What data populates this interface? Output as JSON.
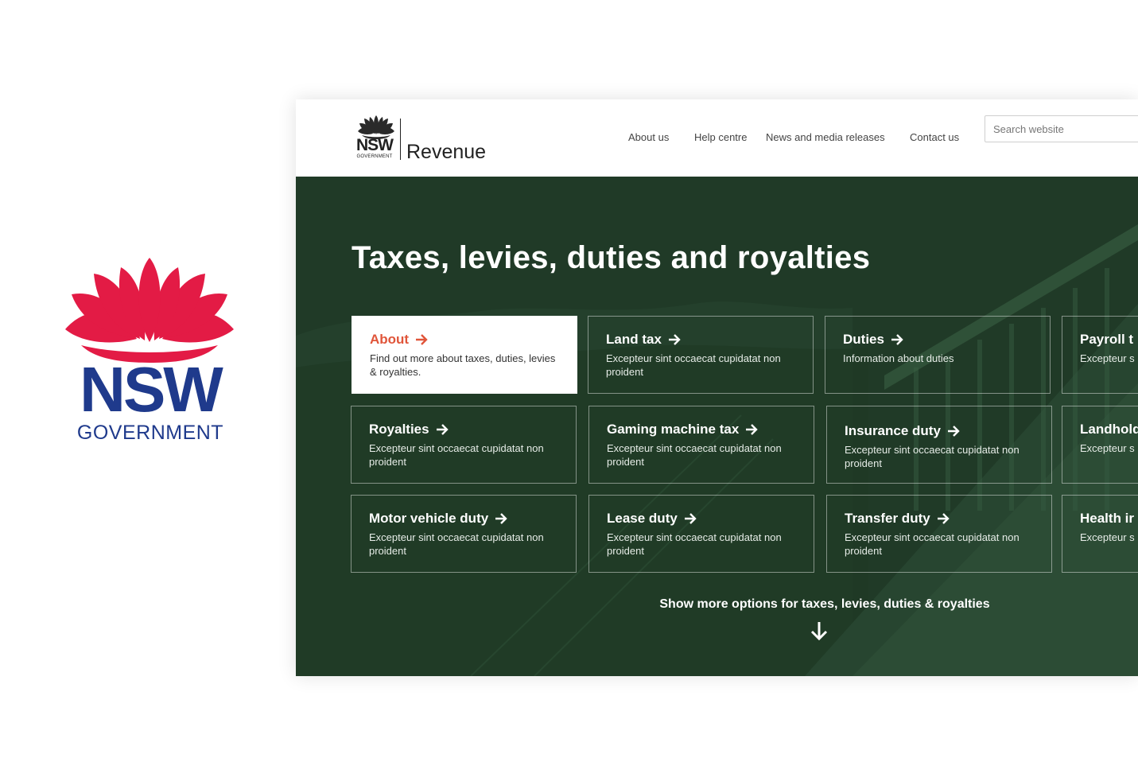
{
  "brand": {
    "nsw": "NSW",
    "government": "GOVERNMENT",
    "waratah_red": "#e31b45",
    "navy": "#1f3a8c"
  },
  "header": {
    "logo_nsw": "NSW",
    "logo_government": "GOVERNMENT",
    "brand_name": "Revenue",
    "nav": [
      "About us",
      "Help centre",
      "News and media releases",
      "Contact us"
    ],
    "search_placeholder": "Search website"
  },
  "hero": {
    "title": "Taxes, levies, duties and royalties",
    "background_color": "#203a27",
    "accent_color": "#e0553a",
    "cards": [
      {
        "title": "About",
        "desc": "Find out more about taxes, duties, levies & royalties.",
        "active": true
      },
      {
        "title": "Land tax",
        "desc": "Excepteur sint occaecat cupidatat non proident",
        "active": false
      },
      {
        "title": "Duties",
        "desc": "Information about duties",
        "active": false
      },
      {
        "title": "Payroll t",
        "desc": "Excepteur s non proiden",
        "active": false
      },
      {
        "title": "Royalties",
        "desc": "Excepteur sint occaecat cupidatat non proident",
        "active": false
      },
      {
        "title": "Gaming machine tax",
        "desc": "Excepteur sint occaecat cupidatat non proident",
        "active": false
      },
      {
        "title": "Insurance duty",
        "desc": "Excepteur sint occaecat cupidatat non proident",
        "active": false
      },
      {
        "title": "Landhold",
        "desc": "Excepteur s non proiden",
        "active": false
      },
      {
        "title": "Motor vehicle duty",
        "desc": "Excepteur sint occaecat cupidatat non proident",
        "active": false
      },
      {
        "title": "Lease duty",
        "desc": "Excepteur sint occaecat cupidatat non proident",
        "active": false
      },
      {
        "title": "Transfer duty",
        "desc": "Excepteur sint occaecat cupidatat non proident",
        "active": false
      },
      {
        "title": "Health ir",
        "desc": "Excepteur s non proiden",
        "active": false
      }
    ],
    "more_label": "Show more options for taxes, levies, duties & royalties"
  }
}
